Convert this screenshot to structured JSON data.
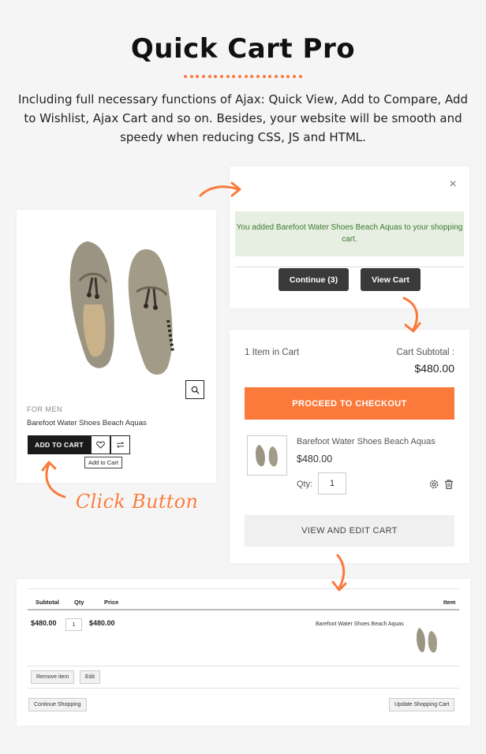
{
  "header": {
    "title": "Quick Cart Pro",
    "description": "Including full necessary functions of Ajax: Quick View, Add to Compare, Add to Wishlist, Ajax Cart and so on. Besides, your website will be smooth and speedy when reducing CSS, JS and HTML."
  },
  "product": {
    "category": "FOR MEN",
    "name": "Barefoot Water Shoes Beach Aquas",
    "add_to_cart_label": "ADD TO CART",
    "tooltip": "Add to Cart",
    "icons": [
      "zoom-icon",
      "wishlist-heart-icon",
      "compare-icon"
    ]
  },
  "popup": {
    "message": "You added Barefoot Water Shoes Beach Aquas to your shopping cart.",
    "continue_label": "Continue (3)",
    "view_cart_label": "View Cart"
  },
  "minicart": {
    "count_label": "1 Item in Cart",
    "subtotal_label": "Cart Subtotal :",
    "subtotal_value": "$480.00",
    "checkout_label": "PROCEED TO CHECKOUT",
    "item_name": "Barefoot Water Shoes Beach Aquas",
    "item_price": "$480.00",
    "qty_label": "Qty:",
    "qty_value": "1",
    "edit_cart_label": "VIEW AND EDIT CART"
  },
  "cart_table": {
    "headers": {
      "subtotal": "Subtotal",
      "qty": "Qty",
      "price": "Price",
      "item": "Item"
    },
    "row": {
      "subtotal": "$480.00",
      "qty": "1",
      "price": "$480.00",
      "item": "Barefoot Water Shoes Beach Aquas"
    },
    "remove_label": "Remove item",
    "edit_label": "Edit",
    "continue_label": "Continue Shopping",
    "update_label": "Update Shopping Cart"
  },
  "annotation": {
    "click_label": "Click Button"
  },
  "colors": {
    "accent": "#fb7a3b",
    "dark_button": "#3a3a3a",
    "success_bg": "#e6efe2",
    "success_text": "#3f7a2f"
  }
}
